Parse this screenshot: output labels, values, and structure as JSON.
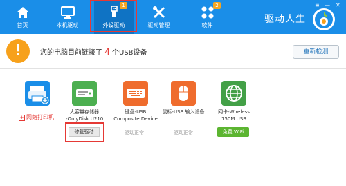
{
  "nav": {
    "items": [
      {
        "label": "首页",
        "icon": "home-icon"
      },
      {
        "label": "本机驱动",
        "icon": "monitor-icon"
      },
      {
        "label": "外设驱动",
        "icon": "usb-icon",
        "badge": "1",
        "active": true
      },
      {
        "label": "驱动管理",
        "icon": "tools-icon"
      },
      {
        "label": "软件",
        "icon": "apps-icon",
        "badge": "2"
      }
    ],
    "brand": "驱动人生",
    "window_controls": [
      "≡",
      "—",
      "✕"
    ]
  },
  "status": {
    "prefix": "您的电脑目前链接了",
    "count": "4",
    "suffix": "个USB设备",
    "rescan_label": "重新检测"
  },
  "devices": [
    {
      "name_line1": "",
      "name_line2": "",
      "icon": "printer-icon",
      "add_label": "网络打印机"
    },
    {
      "name_line1": "大容量存储器",
      "name_line2": "-OnlyDisk U210",
      "icon": "disk-icon",
      "action": "修复驱动"
    },
    {
      "name_line1": "键盘-USB",
      "name_line2": "Composite Device",
      "icon": "keyboard-icon",
      "action": "驱动正常"
    },
    {
      "name_line1": "鼠标-USB 输入设备",
      "name_line2": "",
      "icon": "mouse-icon",
      "action": "驱动正常"
    },
    {
      "name_line1": "网卡-Wireless",
      "name_line2": "150M USB",
      "icon": "globe-icon",
      "action": "免费 WiFi"
    }
  ],
  "colors": {
    "topbar": "#1a8ee8",
    "active_tab": "#0f73c4",
    "warn": "#f7a11b",
    "highlight": "#e53935",
    "wifi": "#5cb531"
  }
}
